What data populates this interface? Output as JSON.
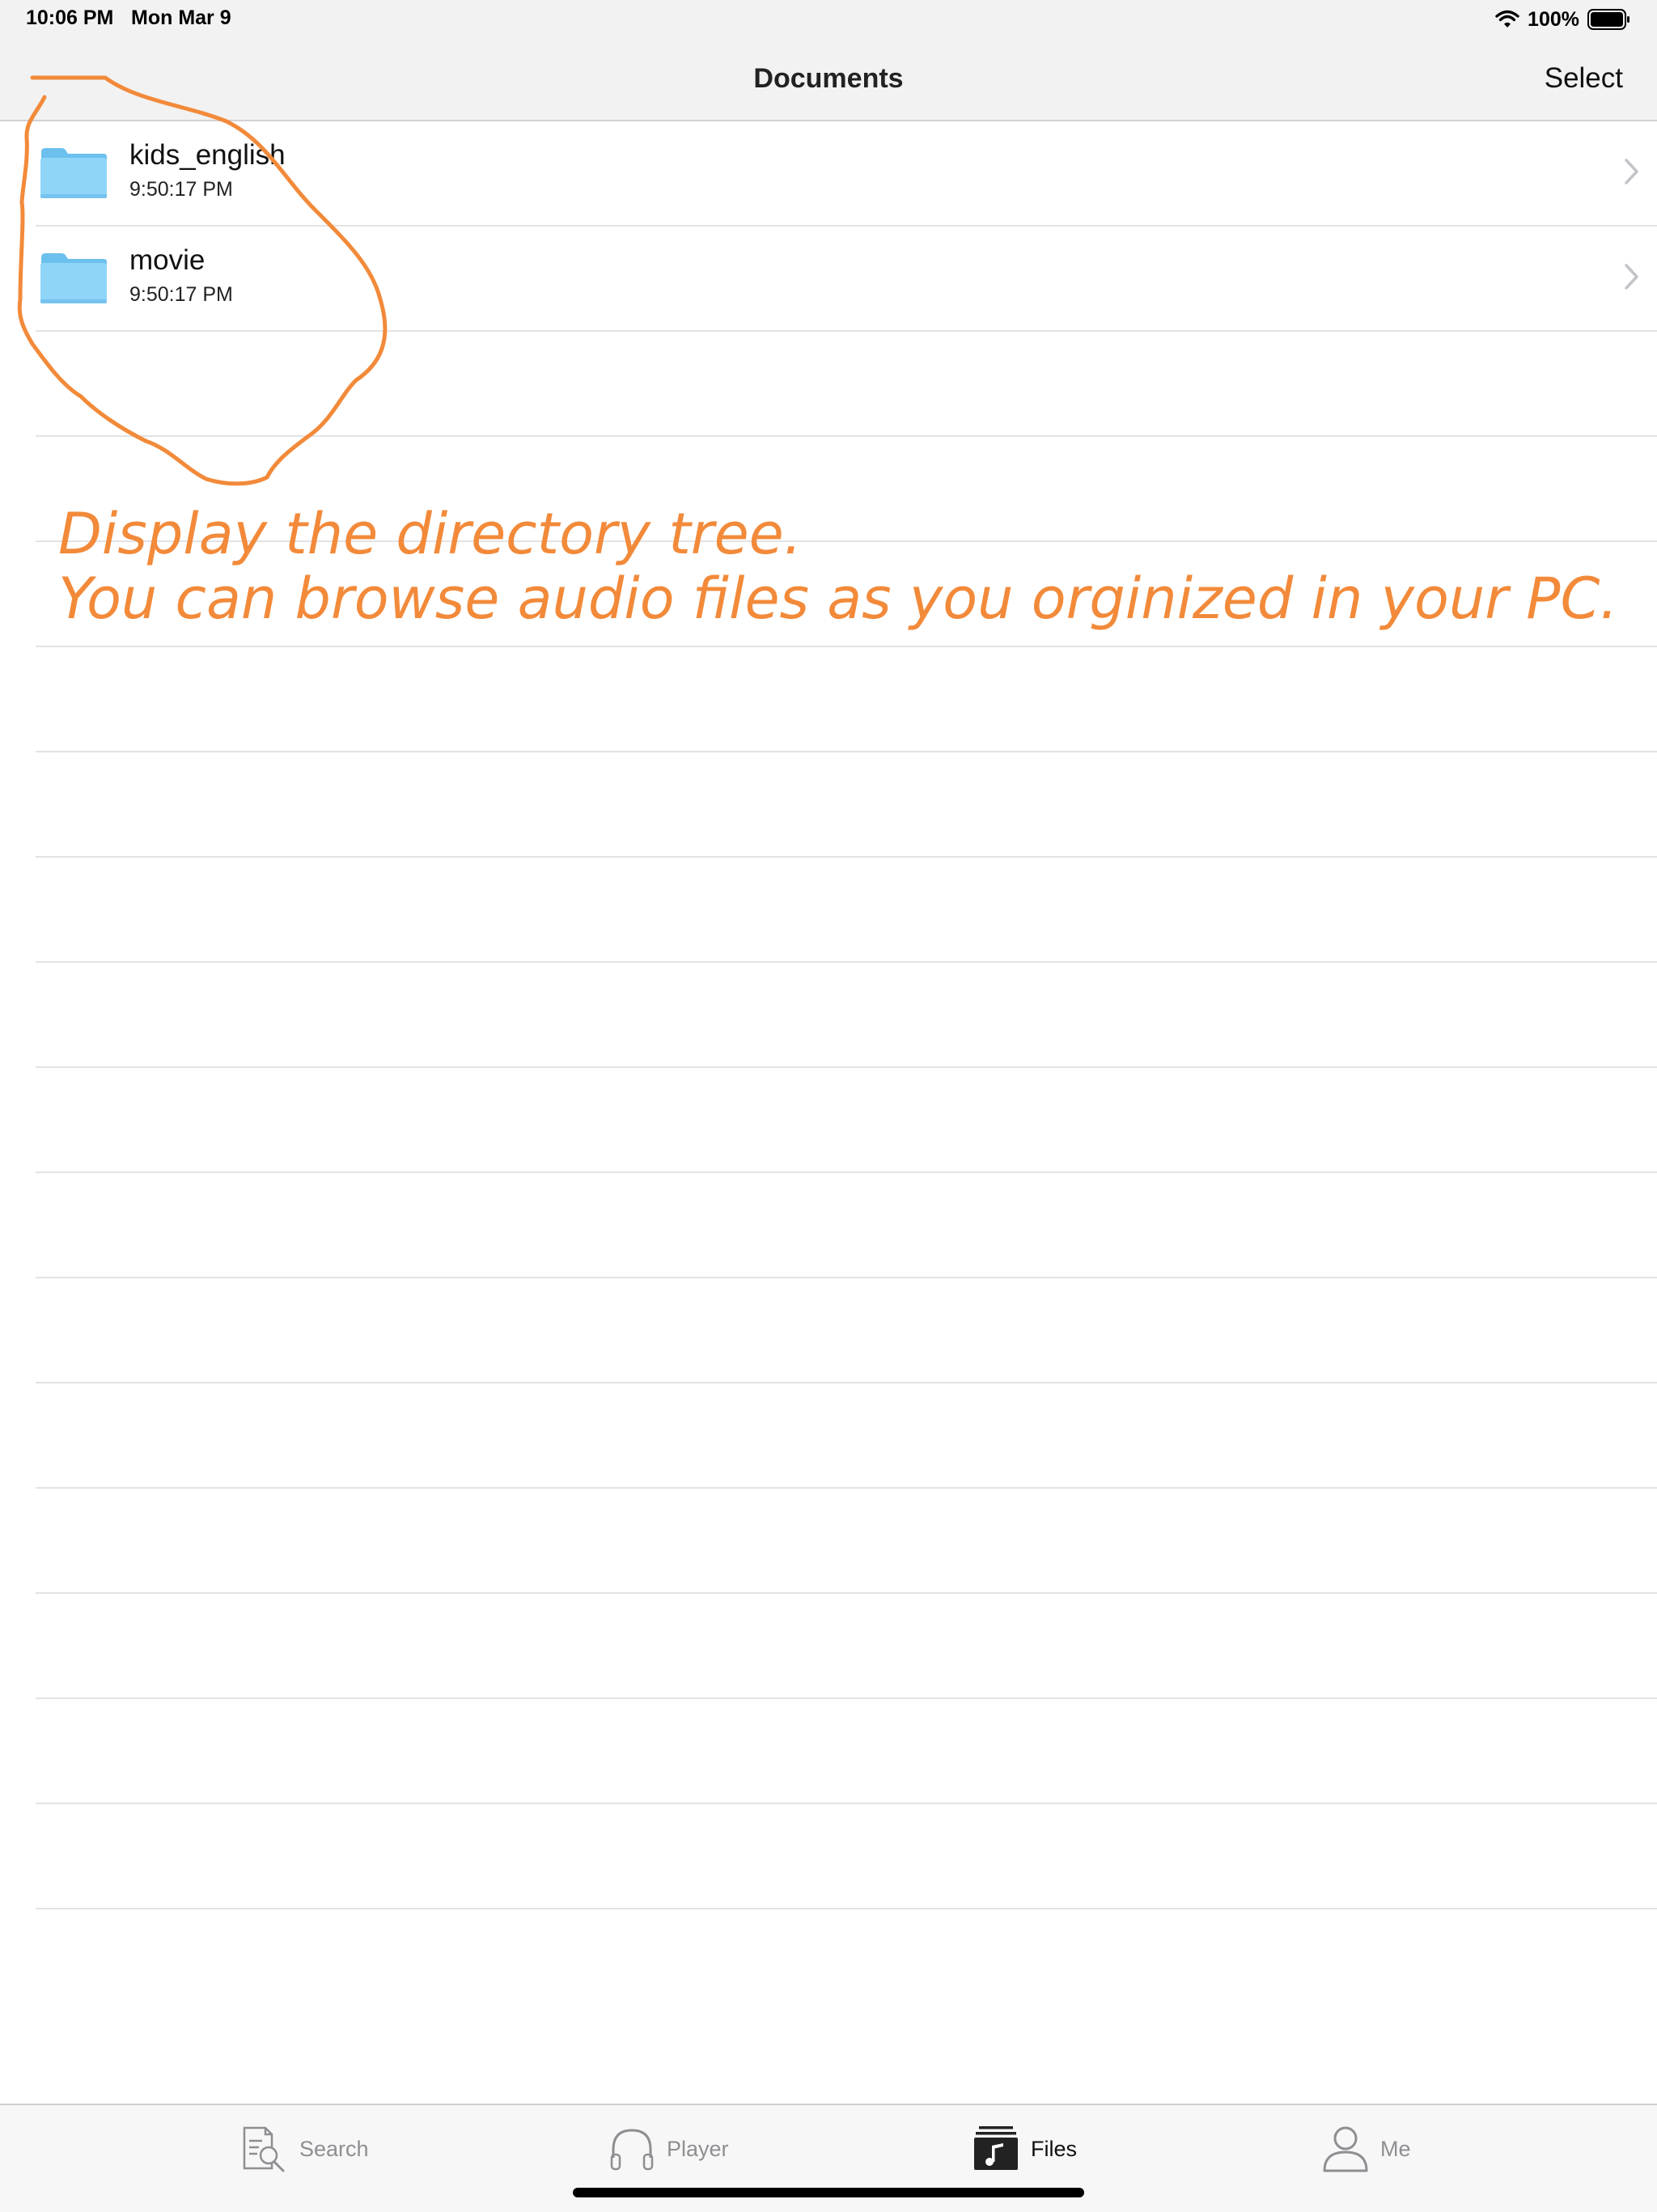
{
  "status_bar": {
    "time": "10:06 PM",
    "date": "Mon Mar 9",
    "battery": "100%"
  },
  "nav": {
    "title": "Documents",
    "select_label": "Select"
  },
  "files": [
    {
      "name": "kids_english",
      "time": "9:50:17 PM",
      "icon": "folder-icon"
    },
    {
      "name": "movie",
      "time": "9:50:17 PM",
      "icon": "folder-icon"
    }
  ],
  "annotation": {
    "line1": "Display the directory tree.",
    "line2": "You can browse audio files as you orginized in your PC.",
    "color": "#f28a3a"
  },
  "tabs": [
    {
      "label": "Search",
      "icon": "search-document-icon",
      "active": false
    },
    {
      "label": "Player",
      "icon": "headphones-icon",
      "active": false
    },
    {
      "label": "Files",
      "icon": "music-files-icon",
      "active": true
    },
    {
      "label": "Me",
      "icon": "person-icon",
      "active": false
    }
  ],
  "colors": {
    "folder": "#7fcdf5",
    "annotation": "#f28a3a",
    "tab_inactive": "#8e8e93",
    "tab_active": "#111111"
  }
}
